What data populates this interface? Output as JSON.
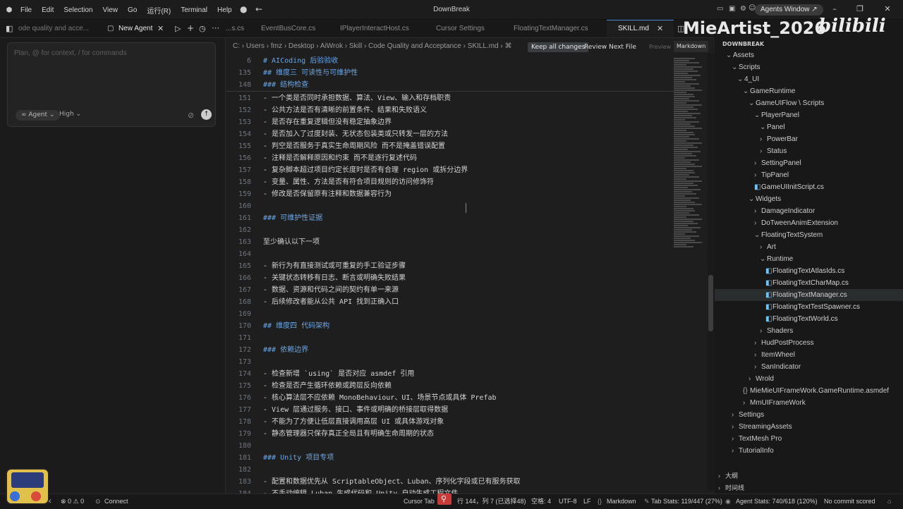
{
  "window": {
    "title": "DownBreak",
    "agents_window": "Agents Window ↗",
    "menu": [
      "File",
      "Edit",
      "Selection",
      "View",
      "Go",
      "运行(R)",
      "Terminal",
      "Help"
    ]
  },
  "left": {
    "tab_prev": "ode quality and acce...",
    "tab_new": "New Agent",
    "placeholder": "Plan, @ for context, / for commands",
    "agent_pill": "∞ Agent ⌄",
    "high": "High ⌄"
  },
  "editor": {
    "tabs": [
      "...s.cs",
      "EventBusCore.cs",
      "IPlayerInteractHost.cs",
      "Cursor Settings",
      "FloatingTextManager.cs",
      "SKILL.md"
    ],
    "breadcrumb": "C: › Users › fmz › Desktop › AiWrok › Skill › Code Quality and Acceptance › SKILL.md › ⌘",
    "keep_all": "Keep all changes",
    "review_next": "Review Next File",
    "preview": "Preview",
    "markdown": "Markdown",
    "lines": [
      {
        "n": "6",
        "t": "# AICoding 后验验收",
        "h": true
      },
      {
        "n": "135",
        "t": "## 维度三 可读性与可维护性",
        "h": true
      },
      {
        "n": "148",
        "t": "### 结构检查",
        "h": true
      },
      {
        "n": "151",
        "t": "- 一个类是否同时承担数据、算法、View、输入和存档职责",
        "h": false
      },
      {
        "n": "152",
        "t": "- 公共方法是否有清晰的前置条件、结果和失败语义",
        "h": false
      },
      {
        "n": "153",
        "t": "- 是否存在重复逻辑但没有稳定抽象边界",
        "h": false
      },
      {
        "n": "154",
        "t": "- 是否加入了过度封装、无状态包装类或只转发一层的方法",
        "h": false
      },
      {
        "n": "155",
        "t": "- 判空是否服务于真实生命周期风险 而不是掩盖错误配置",
        "h": false
      },
      {
        "n": "156",
        "t": "- 注释是否解释原因和约束 而不是逐行复述代码",
        "h": false
      },
      {
        "n": "157",
        "t": "- 复杂脚本超过项目约定长度时是否有合理 region 或拆分边界",
        "h": false
      },
      {
        "n": "158",
        "t": "- 变量、属性、方法是否有符合项目规则的访问修饰符",
        "h": false
      },
      {
        "n": "159",
        "t": "- 修改是否保留原有注释和数据兼容行为",
        "h": false
      },
      {
        "n": "160",
        "t": "",
        "h": false
      },
      {
        "n": "161",
        "t": "### 可维护性证据",
        "h": true
      },
      {
        "n": "162",
        "t": "",
        "h": false
      },
      {
        "n": "163",
        "t": "至少确认以下一项",
        "h": false
      },
      {
        "n": "164",
        "t": "",
        "h": false
      },
      {
        "n": "165",
        "t": "- 新行为有直接测试或可重复的手工验证步骤",
        "h": false
      },
      {
        "n": "166",
        "t": "- 关键状态转移有日志、断言或明确失败结果",
        "h": false
      },
      {
        "n": "167",
        "t": "- 数据、资源和代码之间的契约有单一来源",
        "h": false
      },
      {
        "n": "168",
        "t": "- 后续修改者能从公共 API 找到正确入口",
        "h": false
      },
      {
        "n": "169",
        "t": "",
        "h": false
      },
      {
        "n": "170",
        "t": "## 维度四 代码架构",
        "h": true
      },
      {
        "n": "171",
        "t": "",
        "h": false
      },
      {
        "n": "172",
        "t": "### 依赖边界",
        "h": true
      },
      {
        "n": "173",
        "t": "",
        "h": false
      },
      {
        "n": "174",
        "t": "- 检查新增 `using` 是否对应 asmdef 引用",
        "h": false
      },
      {
        "n": "175",
        "t": "- 检查是否产生循环依赖或跨层反向依赖",
        "h": false
      },
      {
        "n": "176",
        "t": "- 核心算法层不应依赖 MonoBehaviour、UI、场景节点或具体 Prefab",
        "h": false
      },
      {
        "n": "177",
        "t": "- View 层通过服务、接口、事件或明确的桥接层取得数据",
        "h": false
      },
      {
        "n": "178",
        "t": "- 不能为了方便让低层直接调用高层 UI 或具体游戏对象",
        "h": false
      },
      {
        "n": "179",
        "t": "- 静态管理器只保存真正全局且有明确生命周期的状态",
        "h": false
      },
      {
        "n": "180",
        "t": "",
        "h": false
      },
      {
        "n": "181",
        "t": "### Unity 项目专项",
        "h": true
      },
      {
        "n": "182",
        "t": "",
        "h": false
      },
      {
        "n": "183",
        "t": "- 配置和数据优先从 ScriptableObject、Luban、序列化字段或已有服务获取",
        "h": false
      },
      {
        "n": "184",
        "t": "- 不手动编辑 Luban 生成代码和 Unity 自动生成工程文件",
        "h": false
      }
    ]
  },
  "overlay": {
    "banner": "MieArtist_2026",
    "bili": "bilibili"
  },
  "explorer": {
    "root": "DOWNBREAK",
    "items": [
      {
        "label": "Assets",
        "d": 1,
        "c": "⌄",
        "cs": false
      },
      {
        "label": "Scripts",
        "d": 2,
        "c": "⌄",
        "cs": false
      },
      {
        "label": "4_UI",
        "d": 3,
        "c": "⌄",
        "cs": false
      },
      {
        "label": "GameRuntime",
        "d": 4,
        "c": "⌄",
        "cs": false
      },
      {
        "label": "GameUIFlow \\ Scripts",
        "d": 5,
        "c": "⌄",
        "cs": false
      },
      {
        "label": "PlayerPanel",
        "d": 6,
        "c": "⌄",
        "cs": false
      },
      {
        "label": "Panel",
        "d": 7,
        "c": "⌄",
        "cs": false
      },
      {
        "label": "PowerBar",
        "d": 7,
        "c": "›",
        "cs": false
      },
      {
        "label": "Status",
        "d": 7,
        "c": "›",
        "cs": false
      },
      {
        "label": "SettingPanel",
        "d": 6,
        "c": "›",
        "cs": false
      },
      {
        "label": "TipPanel",
        "d": 6,
        "c": "›",
        "cs": false
      },
      {
        "label": "GameUIInitScript.cs",
        "d": 6,
        "c": "◧",
        "cs": true
      },
      {
        "label": "Widgets",
        "d": 5,
        "c": "⌄",
        "cs": false
      },
      {
        "label": "DamageIndicator",
        "d": 6,
        "c": "›",
        "cs": false
      },
      {
        "label": "DoTweenAnimExtension",
        "d": 6,
        "c": "›",
        "cs": false
      },
      {
        "label": "FloatingTextSystem",
        "d": 6,
        "c": "⌄",
        "cs": false
      },
      {
        "label": "Art",
        "d": 7,
        "c": "›",
        "cs": false
      },
      {
        "label": "Runtime",
        "d": 7,
        "c": "⌄",
        "cs": false
      },
      {
        "label": "FloatingTextAtlasIds.cs",
        "d": 8,
        "c": "◧",
        "cs": true
      },
      {
        "label": "FloatingTextCharMap.cs",
        "d": 8,
        "c": "◧",
        "cs": true
      },
      {
        "label": "FloatingTextManager.cs",
        "d": 8,
        "c": "◧",
        "cs": true,
        "sel": true
      },
      {
        "label": "FloatingTextTestSpawner.cs",
        "d": 8,
        "c": "◧",
        "cs": true
      },
      {
        "label": "FloatingTextWorld.cs",
        "d": 8,
        "c": "◧",
        "cs": true
      },
      {
        "label": "Shaders",
        "d": 7,
        "c": "›",
        "cs": false
      },
      {
        "label": "HudPostProcess",
        "d": 6,
        "c": "›",
        "cs": false
      },
      {
        "label": "ItemWheel",
        "d": 6,
        "c": "›",
        "cs": false
      },
      {
        "label": "SanIndicator",
        "d": 6,
        "c": "›",
        "cs": false
      },
      {
        "label": "Wrold",
        "d": 5,
        "c": "›",
        "cs": false
      },
      {
        "label": "MieMieUIFrameWork.GameRuntime.asmdef",
        "d": 4,
        "c": "{}",
        "cs": false
      },
      {
        "label": "MmUIFrameWork",
        "d": 4,
        "c": "›",
        "cs": false
      },
      {
        "label": "Settings",
        "d": 2,
        "c": "›",
        "cs": false
      },
      {
        "label": "StreamingAssets",
        "d": 2,
        "c": "›",
        "cs": false
      },
      {
        "label": "TextMesh Pro",
        "d": 2,
        "c": "›",
        "cs": false
      },
      {
        "label": "TutorialInfo",
        "d": 2,
        "c": "›",
        "cs": false
      }
    ],
    "outline": "大纲",
    "timeline": "时间线"
  },
  "status": {
    "errors": "⊗ 0 ⚠ 0",
    "connect": "Connect",
    "cursor_tab": "Cursor Tab",
    "position": "行 144，列 7 (已选择48)",
    "spaces": "空格: 4",
    "encoding": "UTF-8",
    "eol": "LF",
    "lang": "Markdown",
    "tab_stats": "Tab Stats: 119/447 (27%)",
    "agent_stats": "Agent Stats: 740/618 (120%)",
    "commit": "No commit scored"
  }
}
